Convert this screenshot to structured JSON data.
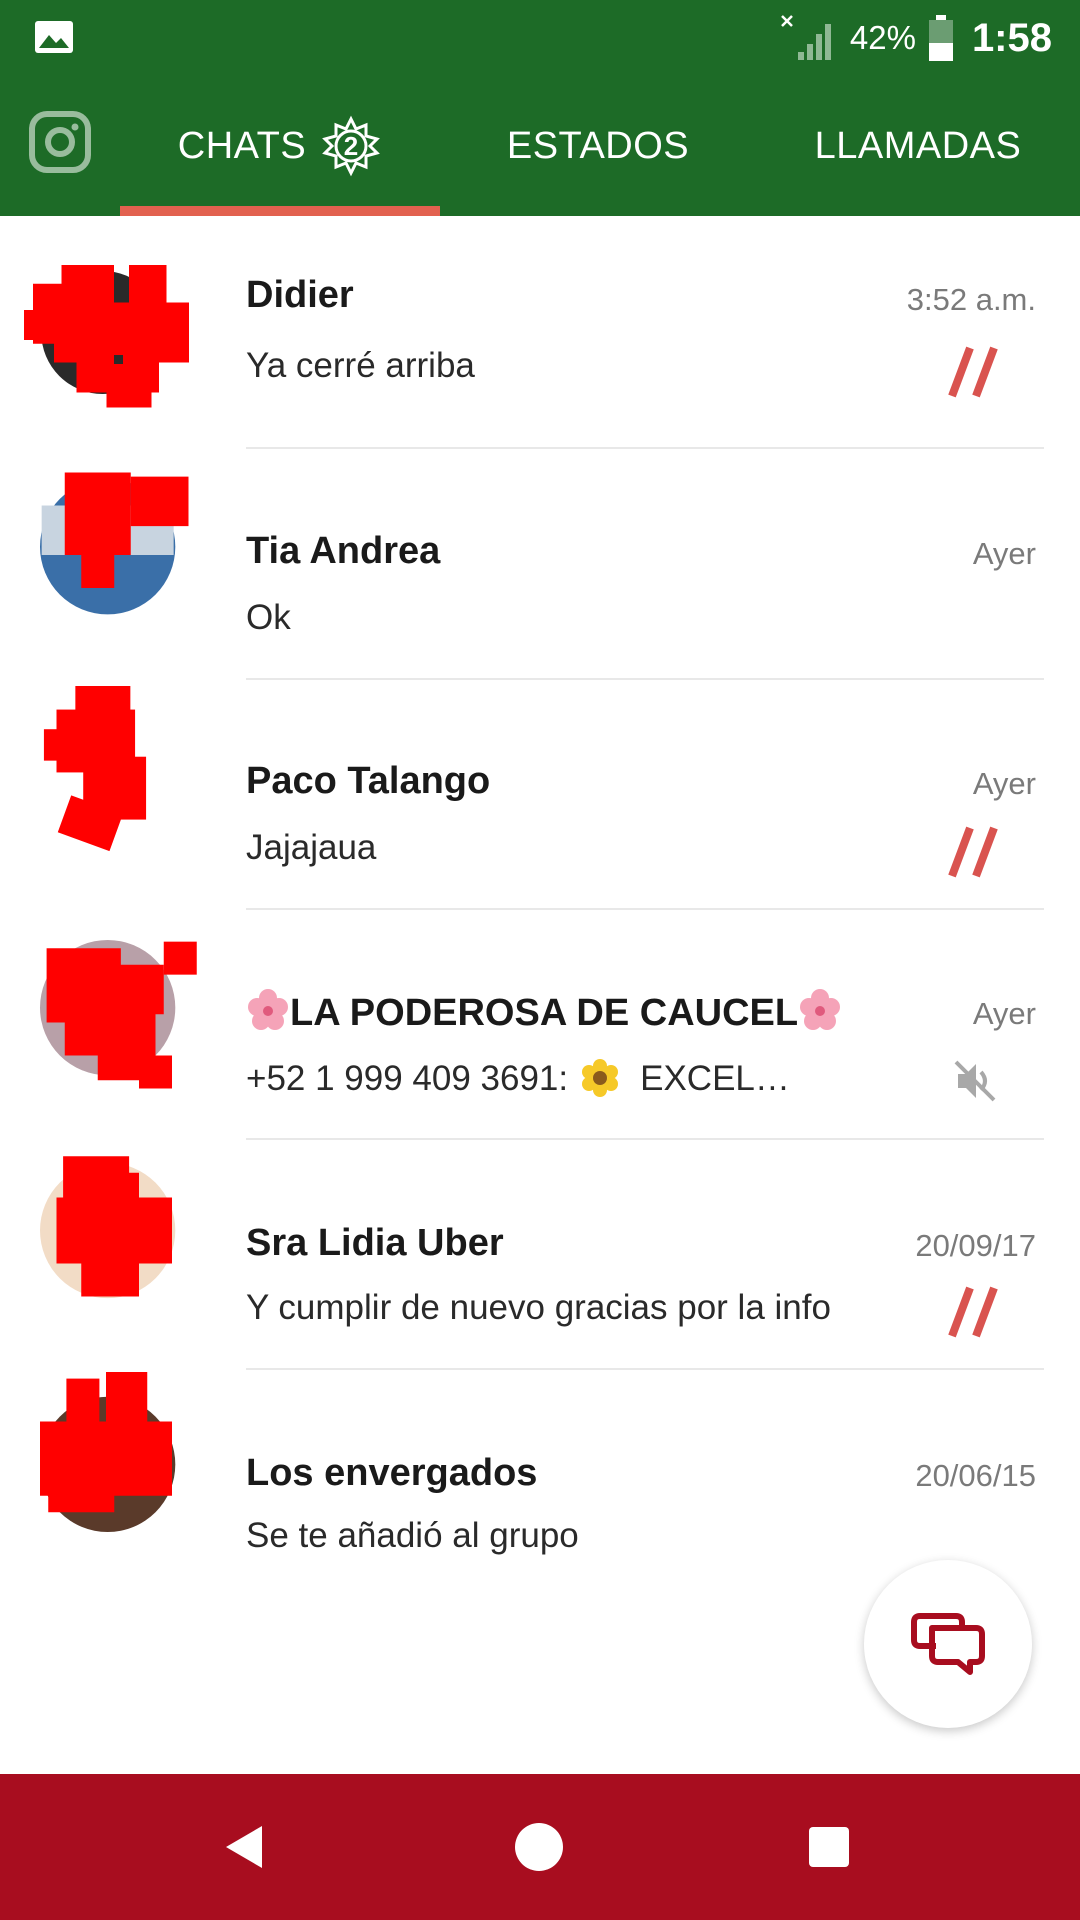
{
  "status_bar": {
    "gallery_icon": "image-icon",
    "signal_icon": "signal-no-data-icon",
    "battery_percent": "42%",
    "battery_icon": "battery-icon",
    "time": "1:58"
  },
  "tabs": {
    "camera_icon": "camera-icon",
    "items": [
      {
        "label": "CHATS",
        "badge": "2",
        "selected": true
      },
      {
        "label": "ESTADOS",
        "selected": false
      },
      {
        "label": "LLAMADAS",
        "selected": false
      }
    ]
  },
  "chats": [
    {
      "name": "Didier",
      "time": "3:52 a.m.",
      "preview": "Ya cerré arriba",
      "status_icon": "double-check-icon"
    },
    {
      "name": "Tia Andrea",
      "time": "Ayer",
      "preview": "Ok"
    },
    {
      "name": "Paco Talango",
      "time": "Ayer",
      "preview": "Jajajaua",
      "status_icon": "double-check-icon"
    },
    {
      "name": "LA PODEROSA DE CAUCEL",
      "name_decoration": "cherry-blossom-icon",
      "time": "Ayer",
      "preview_prefix": "+52 1 999 409 3691:",
      "preview_emoji": "sunflower-icon",
      "preview": "EXCEL…",
      "status_icon": "mute-icon"
    },
    {
      "name": "Sra Lidia Uber",
      "time": "20/09/17",
      "preview": "Y cumplir de nuevo gracias por la info",
      "status_icon": "double-check-icon"
    },
    {
      "name": "Los envergados",
      "time": "20/06/15",
      "preview": "Se te añadió al grupo"
    }
  ],
  "fab": {
    "icon": "new-chat-icon"
  },
  "nav_bar": {
    "back_icon": "back-icon",
    "home_icon": "home-icon",
    "recents_icon": "recents-icon"
  },
  "colors": {
    "header_green": "#1d6b27",
    "tab_indicator": "#e2614f",
    "tick_red": "#d9534f",
    "nav_red": "#a80d1f",
    "fab_icon": "#a80d1f"
  }
}
